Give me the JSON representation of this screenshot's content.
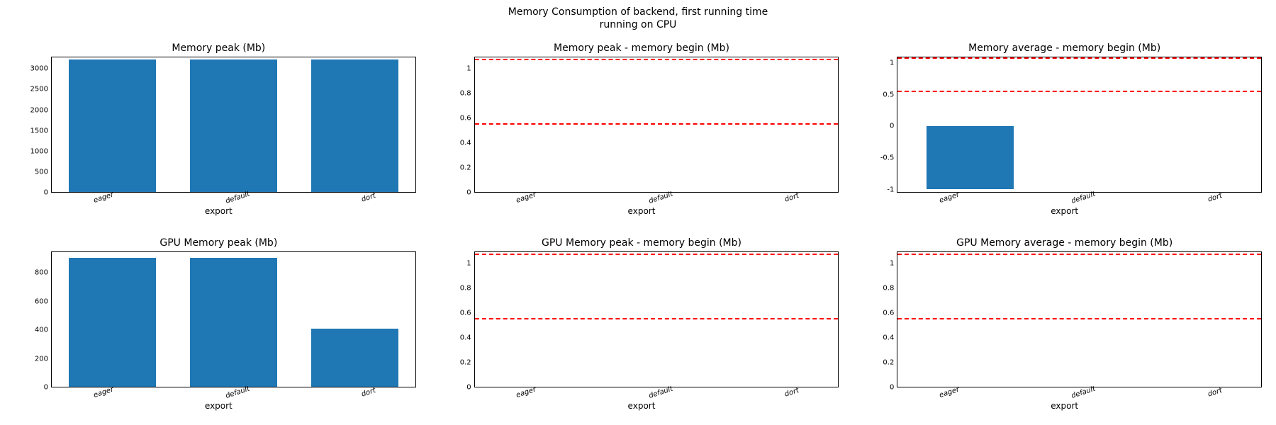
{
  "suptitle_line1": "Memory Consumption of backend, first running time",
  "suptitle_line2": "running on CPU",
  "xlabel": "export",
  "categories": [
    "eager",
    "default",
    "dort"
  ],
  "red_line_low": 0.55,
  "red_line_high": 1.08,
  "chart_data": [
    {
      "type": "bar",
      "title": "Memory peak (Mb)",
      "categories": [
        "eager",
        "default",
        "dort"
      ],
      "values": [
        3250,
        3250,
        3250
      ],
      "ylim": [
        0,
        3300
      ],
      "yticks": [
        0,
        500,
        1000,
        1500,
        2000,
        2500,
        3000
      ],
      "xlabel": "export",
      "red_lines": []
    },
    {
      "type": "bar",
      "title": "Memory peak - memory begin (Mb)",
      "categories": [
        "eager",
        "default",
        "dort"
      ],
      "values": [
        0,
        0,
        0
      ],
      "ylim": [
        0,
        1.1
      ],
      "yticks": [
        0.0,
        0.2,
        0.4,
        0.6,
        0.8,
        1.0
      ],
      "xlabel": "export",
      "red_lines": [
        0.55,
        1.08
      ]
    },
    {
      "type": "bar",
      "title": "Memory average - memory begin (Mb)",
      "categories": [
        "eager",
        "default",
        "dort"
      ],
      "values": [
        -1.0,
        0,
        0
      ],
      "ylim": [
        -1.05,
        1.1
      ],
      "yticks": [
        -1.0,
        -0.5,
        0.0,
        0.5,
        1.0
      ],
      "xlabel": "export",
      "red_lines": [
        0.55,
        1.08
      ]
    },
    {
      "type": "bar",
      "title": "GPU Memory peak (Mb)",
      "categories": [
        "eager",
        "default",
        "dort"
      ],
      "values": [
        910,
        910,
        410
      ],
      "ylim": [
        0,
        950
      ],
      "yticks": [
        0,
        200,
        400,
        600,
        800
      ],
      "xlabel": "export",
      "red_lines": []
    },
    {
      "type": "bar",
      "title": "GPU Memory peak - memory begin (Mb)",
      "categories": [
        "eager",
        "default",
        "dort"
      ],
      "values": [
        0,
        0,
        0
      ],
      "ylim": [
        0,
        1.1
      ],
      "yticks": [
        0.0,
        0.2,
        0.4,
        0.6,
        0.8,
        1.0
      ],
      "xlabel": "export",
      "red_lines": [
        0.55,
        1.08
      ]
    },
    {
      "type": "bar",
      "title": "GPU Memory average - memory begin (Mb)",
      "categories": [
        "eager",
        "default",
        "dort"
      ],
      "values": [
        0,
        0,
        0
      ],
      "ylim": [
        0,
        1.1
      ],
      "yticks": [
        0.0,
        0.2,
        0.4,
        0.6,
        0.8,
        1.0
      ],
      "xlabel": "export",
      "red_lines": [
        0.55,
        1.08
      ]
    }
  ]
}
